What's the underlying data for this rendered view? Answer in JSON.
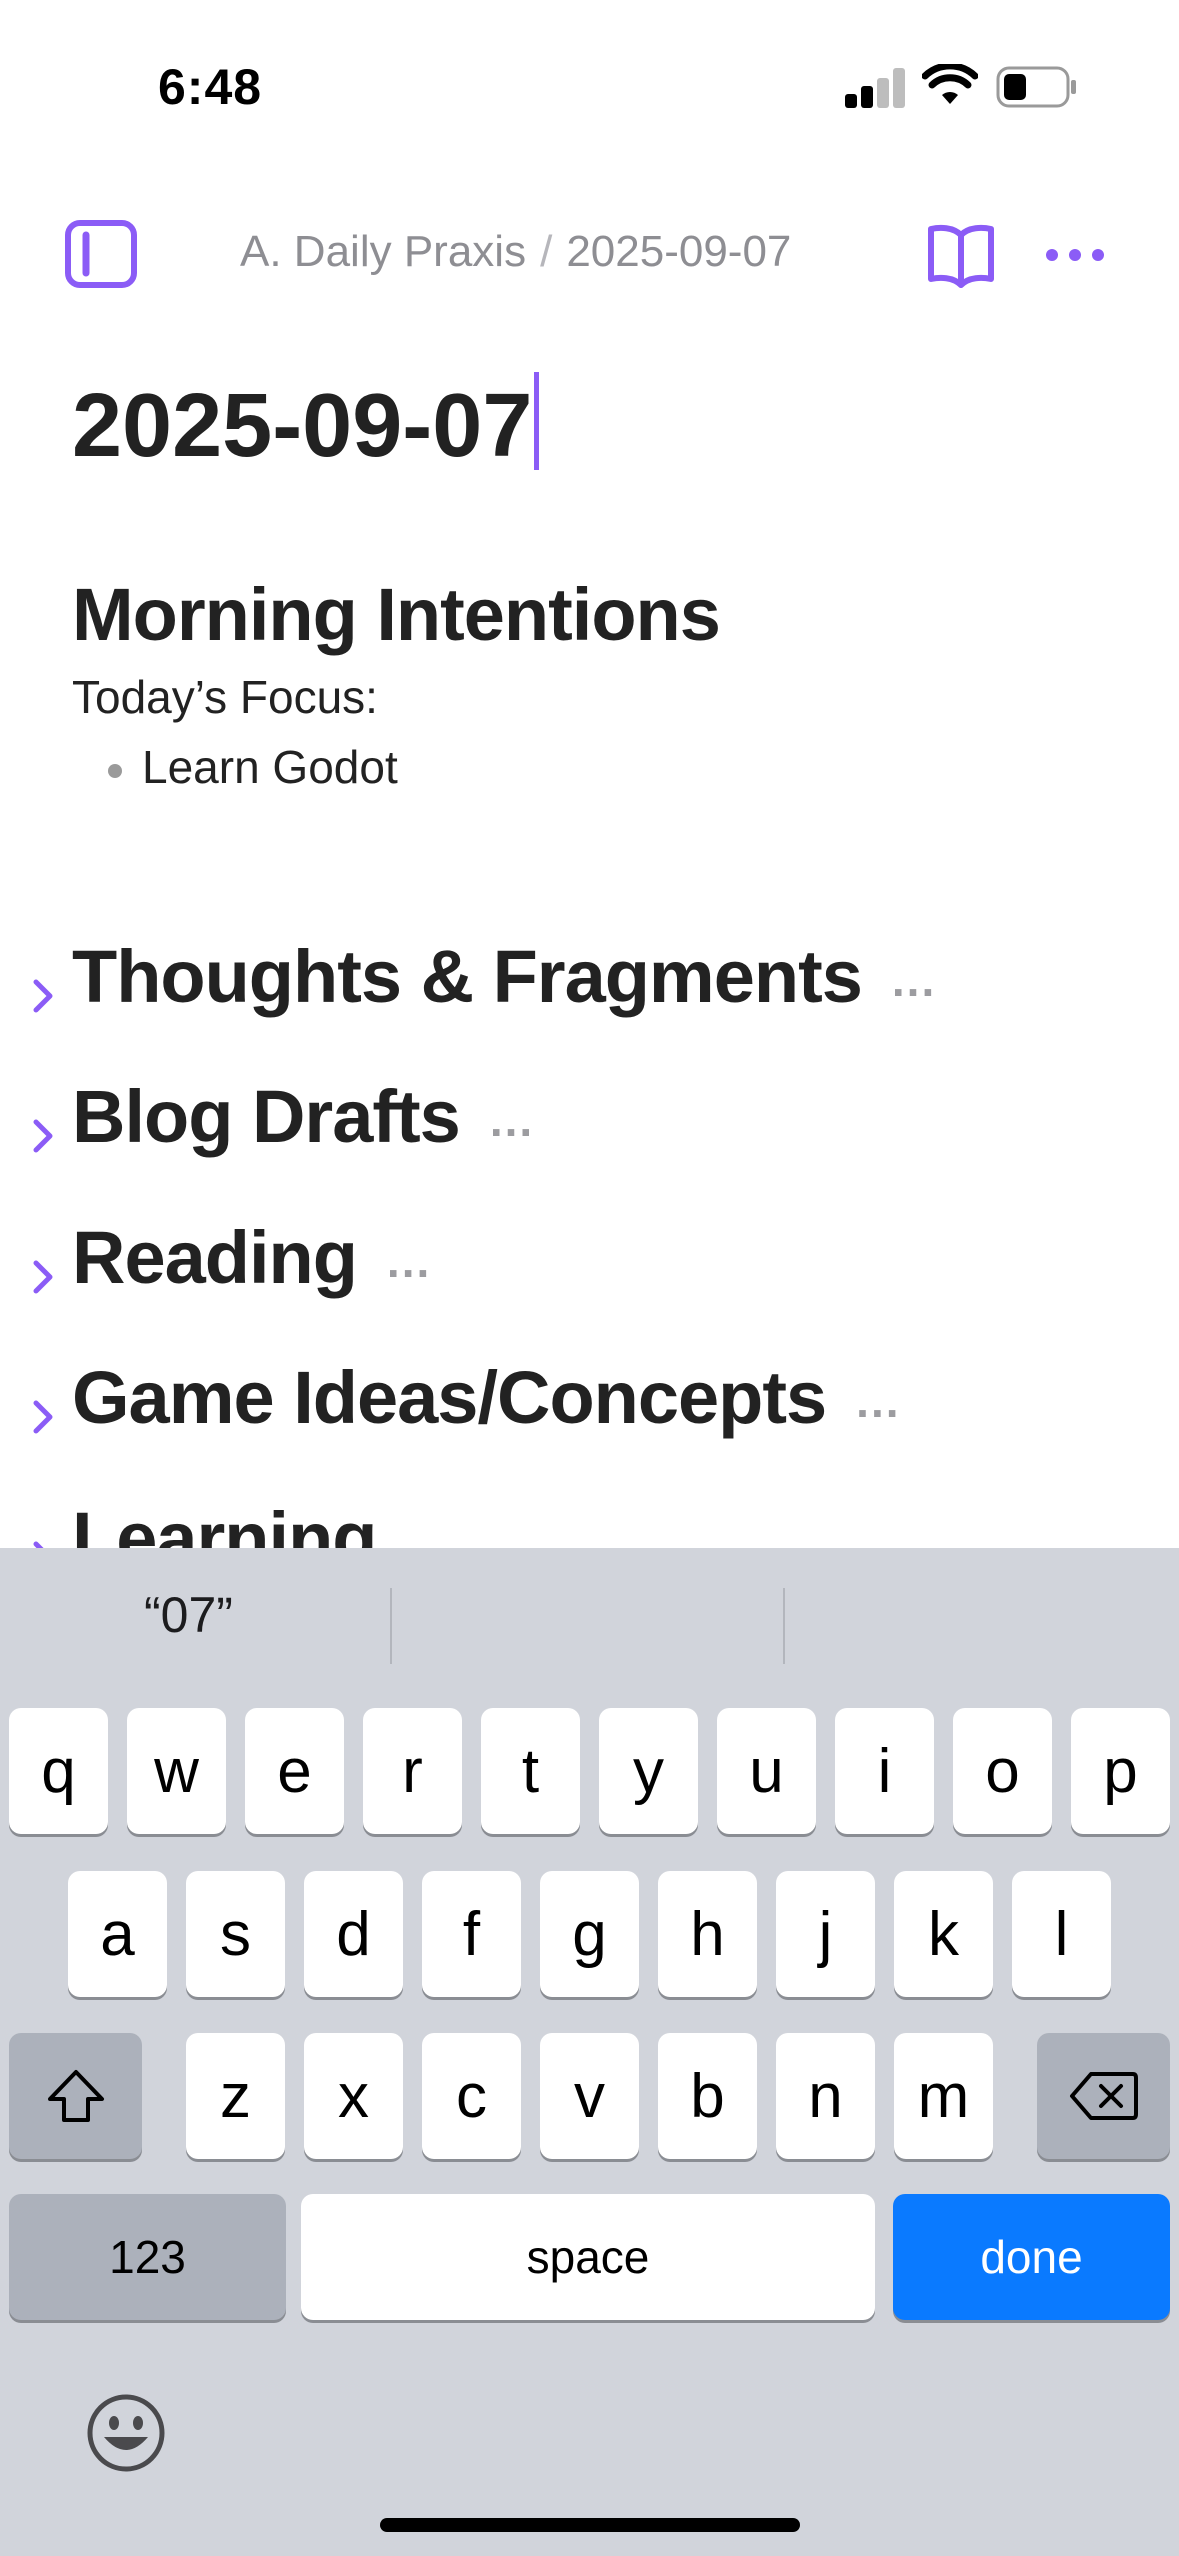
{
  "status_bar": {
    "time": "6:48"
  },
  "nav": {
    "breadcrumb_parent": "A. Daily Praxis",
    "breadcrumb_separator": "/",
    "breadcrumb_current": "2025-09-07",
    "icons": [
      "sidebar-toggle-icon",
      "book-icon",
      "more-icon"
    ]
  },
  "page": {
    "title": "2025-09-07",
    "morning_heading": "Morning Intentions",
    "focus_label": "Today’s Focus:",
    "focus_items": [
      "Learn Godot"
    ],
    "sections": [
      {
        "title": "Thoughts & Fragments",
        "collapsed_marker": "..."
      },
      {
        "title": "Blog Drafts",
        "collapsed_marker": "..."
      },
      {
        "title": "Reading",
        "collapsed_marker": "..."
      },
      {
        "title": "Game Ideas/Concepts",
        "collapsed_marker": "..."
      },
      {
        "title": "Learning",
        "collapsed_marker": ""
      }
    ]
  },
  "keyboard": {
    "suggestions": [
      "“07”",
      "",
      ""
    ],
    "row1": [
      "q",
      "w",
      "e",
      "r",
      "t",
      "y",
      "u",
      "i",
      "o",
      "p"
    ],
    "row2": [
      "a",
      "s",
      "d",
      "f",
      "g",
      "h",
      "j",
      "k",
      "l"
    ],
    "row3": [
      "z",
      "x",
      "c",
      "v",
      "b",
      "n",
      "m"
    ],
    "numbers_label": "123",
    "space_label": "space",
    "done_label": "done"
  },
  "colors": {
    "accent": "#8b5cf6",
    "done_button": "#0a7aff",
    "keyboard_bg": "#d1d4db",
    "special_key": "#acb1bb"
  }
}
